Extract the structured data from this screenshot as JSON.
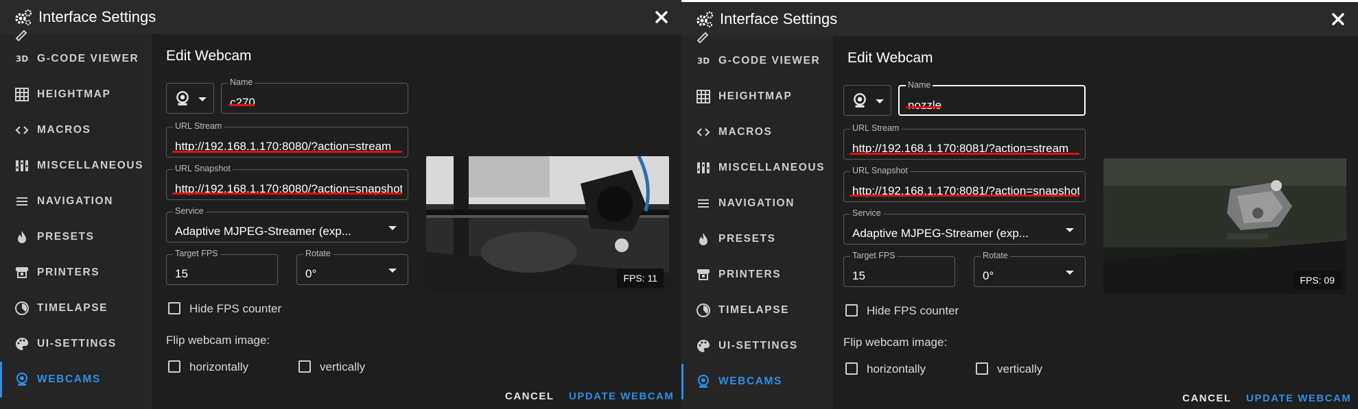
{
  "panels": [
    {
      "title": "Interface Settings",
      "sidebar": {
        "items": [
          {
            "label": "G-CODE VIEWER",
            "icon": "3d-icon"
          },
          {
            "label": "HEIGHTMAP",
            "icon": "grid-icon"
          },
          {
            "label": "MACROS",
            "icon": "code-icon"
          },
          {
            "label": "MISCELLANEOUS",
            "icon": "equalizer-icon"
          },
          {
            "label": "NAVIGATION",
            "icon": "menu-icon"
          },
          {
            "label": "PRESETS",
            "icon": "fire-icon"
          },
          {
            "label": "PRINTERS",
            "icon": "printer-icon"
          },
          {
            "label": "TIMELAPSE",
            "icon": "timelapse-icon"
          },
          {
            "label": "UI-SETTINGS",
            "icon": "palette-icon"
          },
          {
            "label": "WEBCAMS",
            "icon": "webcam-icon",
            "active": true
          }
        ]
      },
      "edit": {
        "heading": "Edit Webcam",
        "name_label": "Name",
        "name_value": "c270",
        "url_stream_label": "URL Stream",
        "url_stream_value": "http://192.168.1.170:8080/?action=stream",
        "url_snapshot_label": "URL Snapshot",
        "url_snapshot_value": "http://192.168.1.170:8080/?action=snapshot",
        "service_label": "Service",
        "service_value": "Adaptive MJPEG-Streamer (exp...",
        "fps_label": "Target FPS",
        "fps_value": "15",
        "rotate_label": "Rotate",
        "rotate_value": "0°",
        "hide_fps_label": "Hide FPS counter",
        "flip_label": "Flip webcam image:",
        "horizontally_label": "horizontally",
        "vertically_label": "vertically",
        "fps_badge": "FPS: 11"
      },
      "buttons": {
        "cancel": "CANCEL",
        "update": "UPDATE WEBCAM"
      }
    },
    {
      "title": "Interface Settings",
      "sidebar": {
        "items": [
          {
            "label": "G-CODE VIEWER",
            "icon": "3d-icon"
          },
          {
            "label": "HEIGHTMAP",
            "icon": "grid-icon"
          },
          {
            "label": "MACROS",
            "icon": "code-icon"
          },
          {
            "label": "MISCELLANEOUS",
            "icon": "equalizer-icon"
          },
          {
            "label": "NAVIGATION",
            "icon": "menu-icon"
          },
          {
            "label": "PRESETS",
            "icon": "fire-icon"
          },
          {
            "label": "PRINTERS",
            "icon": "printer-icon"
          },
          {
            "label": "TIMELAPSE",
            "icon": "timelapse-icon"
          },
          {
            "label": "UI-SETTINGS",
            "icon": "palette-icon"
          },
          {
            "label": "WEBCAMS",
            "icon": "webcam-icon",
            "active": true
          }
        ]
      },
      "edit": {
        "heading": "Edit Webcam",
        "name_label": "Name",
        "name_value": "nozzle",
        "url_stream_label": "URL Stream",
        "url_stream_value": "http://192.168.1.170:8081/?action=stream",
        "url_snapshot_label": "URL Snapshot",
        "url_snapshot_value": "http://192.168.1.170:8081/?action=snapshot",
        "service_label": "Service",
        "service_value": "Adaptive MJPEG-Streamer (exp...",
        "fps_label": "Target FPS",
        "fps_value": "15",
        "rotate_label": "Rotate",
        "rotate_value": "0°",
        "hide_fps_label": "Hide FPS counter",
        "flip_label": "Flip webcam image:",
        "horizontally_label": "horizontally",
        "vertically_label": "vertically",
        "fps_badge": "FPS: 09"
      },
      "buttons": {
        "cancel": "CANCEL",
        "update": "UPDATE WEBCAM"
      }
    }
  ],
  "colors": {
    "accent": "#2f8ee5",
    "annotation_underline": "#e01010",
    "background": "#1e1e1e"
  }
}
